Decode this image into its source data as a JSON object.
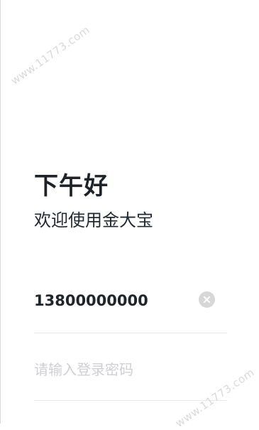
{
  "screen": {
    "greeting": "下午好",
    "subtitle": "欢迎使用金大宝"
  },
  "login": {
    "phone_value": "13800000000",
    "password_placeholder": "请输入登录密码",
    "clear_icon": "clear-icon"
  },
  "watermarks": {
    "top": "www.11773.com",
    "bottom": "www.11773.com"
  }
}
